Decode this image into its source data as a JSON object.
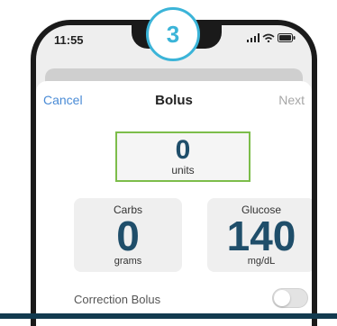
{
  "step": {
    "number": "3"
  },
  "status_bar": {
    "time": "11:55"
  },
  "nav": {
    "cancel": "Cancel",
    "title": "Bolus",
    "next": "Next"
  },
  "bolus": {
    "value": "0",
    "unit": "units"
  },
  "carbs": {
    "label": "Carbs",
    "value": "0",
    "unit": "grams"
  },
  "glucose": {
    "label": "Glucose",
    "value": "140",
    "unit": "mg/dL"
  },
  "correction": {
    "label": "Correction Bolus",
    "enabled": false
  },
  "colors": {
    "accent_blue": "#4a8bd6",
    "step_badge": "#3bb4d8",
    "highlight_green": "#7cbd4a",
    "value_navy": "#1f4e6a",
    "bottom_bar": "#123a4f"
  },
  "icons": [
    "signal-icon",
    "wifi-icon",
    "battery-icon"
  ]
}
